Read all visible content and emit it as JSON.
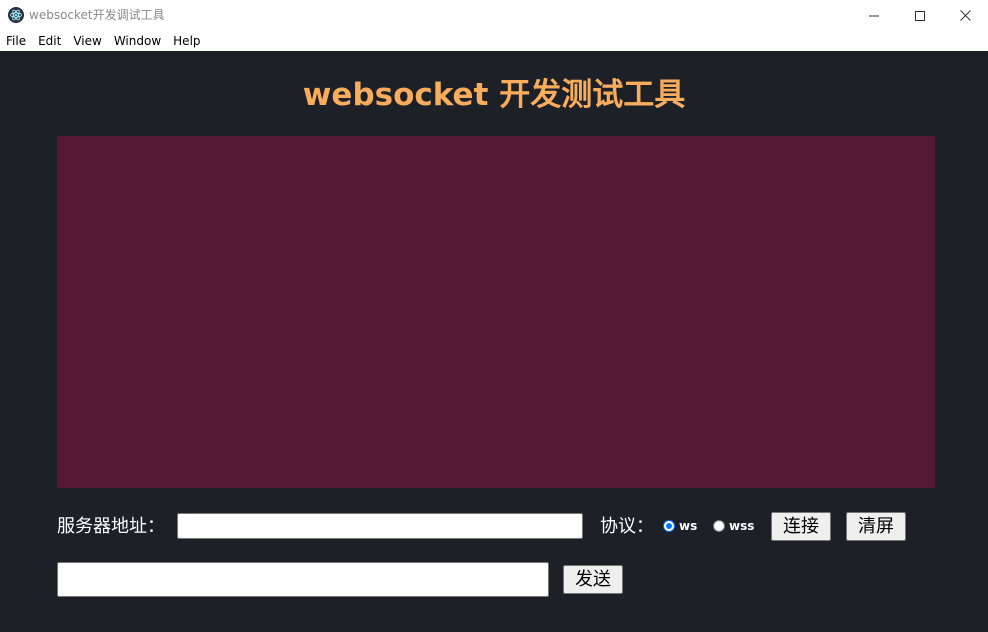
{
  "window": {
    "title": "websocket开发调试工具"
  },
  "menubar": {
    "items": [
      "File",
      "Edit",
      "View",
      "Window",
      "Help"
    ]
  },
  "page": {
    "heading": "websocket 开发测试工具"
  },
  "colors": {
    "background": "#1e2028",
    "heading": "#f9ad5c",
    "output_panel": "#551934",
    "radio_accent": "#0075ff"
  },
  "connection": {
    "server_label": "服务器地址：",
    "server_value": "",
    "protocol_label": "协议：",
    "protocol_options": [
      "ws",
      "wss"
    ],
    "protocol_selected": "ws",
    "connect_label": "连接",
    "clear_label": "清屏"
  },
  "message": {
    "input_value": "",
    "send_label": "发送"
  },
  "icons": {
    "app": "electron-icon",
    "minimize": "minimize-icon",
    "maximize": "maximize-icon",
    "close": "close-icon"
  }
}
